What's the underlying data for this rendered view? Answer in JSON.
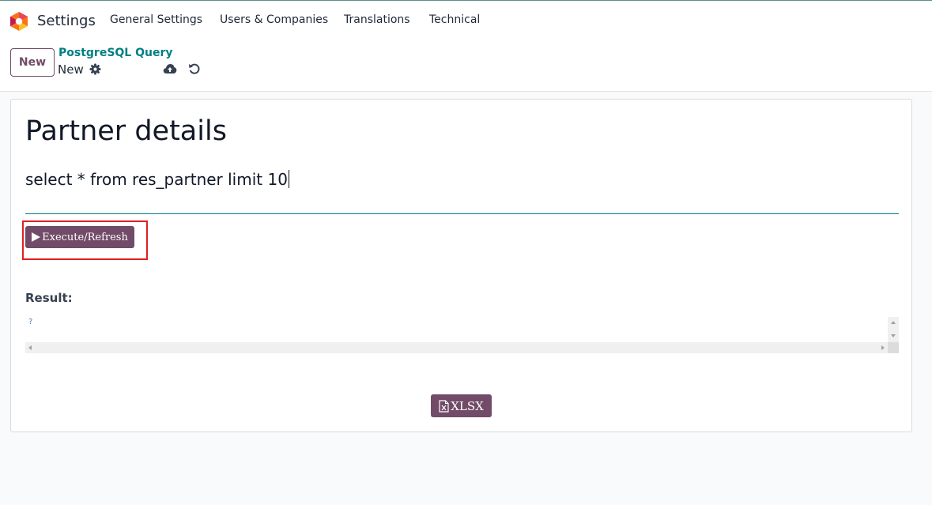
{
  "navbar": {
    "app_name": "Settings",
    "menu": [
      "General Settings",
      "Users & Companies",
      "Translations",
      "Technical"
    ]
  },
  "control_panel": {
    "new_button": "New",
    "breadcrumb": "PostgreSQL Query",
    "record_name": "New",
    "icons": [
      "gear-icon",
      "cloud-upload-icon",
      "undo-icon"
    ]
  },
  "form": {
    "title": "Partner details",
    "query": "select * from res_partner limit 10",
    "execute_button": "Execute/Refresh",
    "result_label": "Result:",
    "result_text": "?",
    "xlsx_button": "XLSX"
  },
  "colors": {
    "brand": "#714b67",
    "link": "#017e84",
    "highlight": "#e02020"
  }
}
